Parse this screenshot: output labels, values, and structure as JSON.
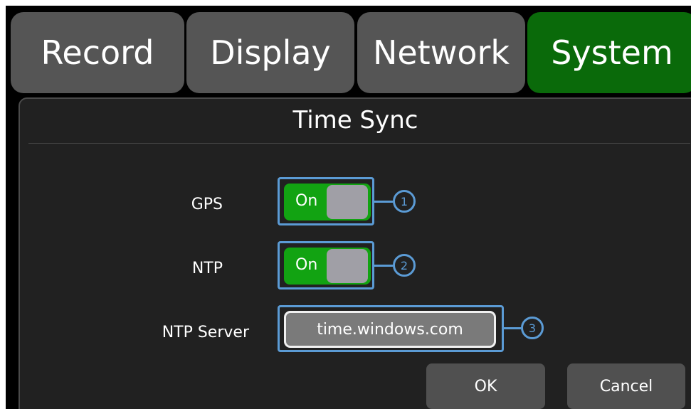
{
  "tabs": [
    {
      "label": "Record",
      "active": false
    },
    {
      "label": "Display",
      "active": false
    },
    {
      "label": "Network",
      "active": false
    },
    {
      "label": "System",
      "active": true
    }
  ],
  "panel": {
    "title": "Time Sync",
    "gps": {
      "label": "GPS",
      "state": "On",
      "callout": "1"
    },
    "ntp": {
      "label": "NTP",
      "state": "On",
      "callout": "2"
    },
    "ntp_server": {
      "label": "NTP Server",
      "value": "time.windows.com",
      "callout": "3"
    }
  },
  "buttons": {
    "ok": "OK",
    "cancel": "Cancel"
  },
  "colors": {
    "active_tab": "#0a6a0a",
    "toggle_on": "#12a312",
    "callout": "#5b9bd5"
  }
}
